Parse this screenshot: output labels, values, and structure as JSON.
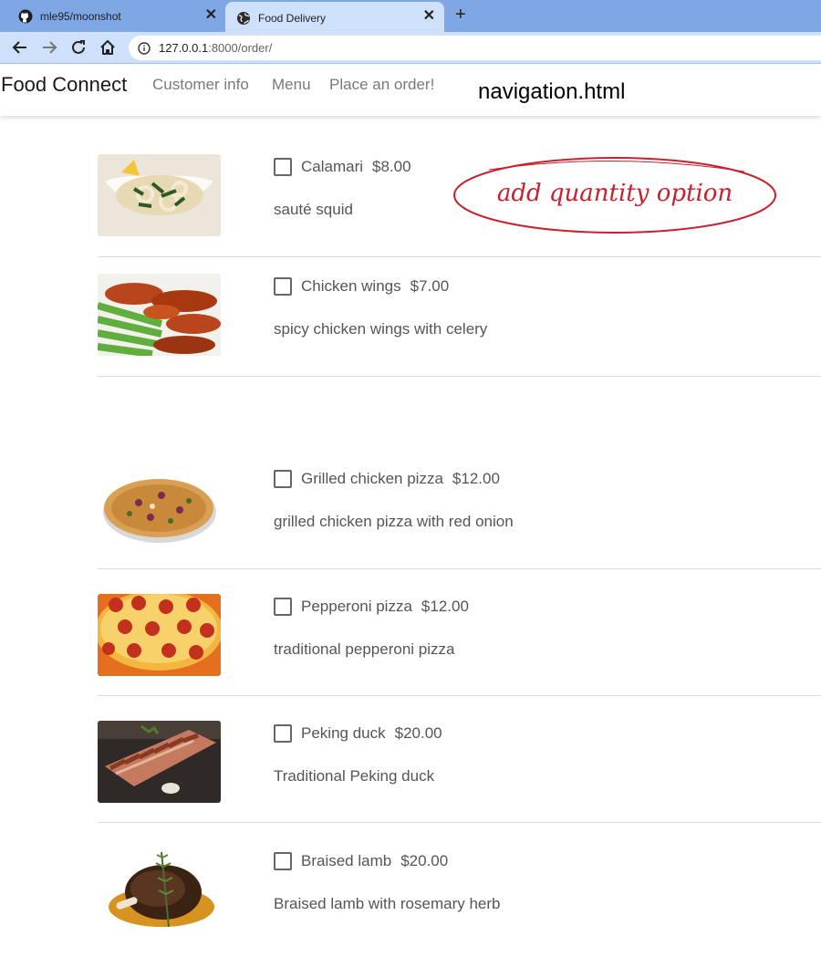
{
  "browser": {
    "tabs": [
      {
        "title": "mle95/moonshot",
        "icon": "github-icon"
      },
      {
        "title": "Food Delivery",
        "icon": "globe-icon"
      }
    ],
    "url_host": "127.0.0.1",
    "url_path": ":8000/order/"
  },
  "navbar": {
    "brand": "Food Connect",
    "links": [
      "Customer info",
      "Menu",
      "Place an order!"
    ],
    "note": "navigation.html"
  },
  "annotation": "add quantity option",
  "menu": [
    {
      "name": "Calamari",
      "price": "$8.00",
      "description": "sauté squid",
      "image": "calamari-image"
    },
    {
      "name": "Chicken wings",
      "price": "$7.00",
      "description": "spicy chicken wings with celery",
      "image": "chicken-wings-image"
    },
    {
      "name": "Grilled chicken pizza",
      "price": "$12.00",
      "description": "grilled chicken pizza with red onion",
      "image": "grilled-chicken-pizza-image"
    },
    {
      "name": "Pepperoni pizza",
      "price": "$12.00",
      "description": "traditional pepperoni pizza",
      "image": "pepperoni-pizza-image"
    },
    {
      "name": "Peking duck",
      "price": "$20.00",
      "description": "Traditional Peking duck",
      "image": "peking-duck-image"
    },
    {
      "name": "Braised lamb",
      "price": "$20.00",
      "description": "Braised lamb with rosemary herb",
      "image": "braised-lamb-image"
    }
  ]
}
